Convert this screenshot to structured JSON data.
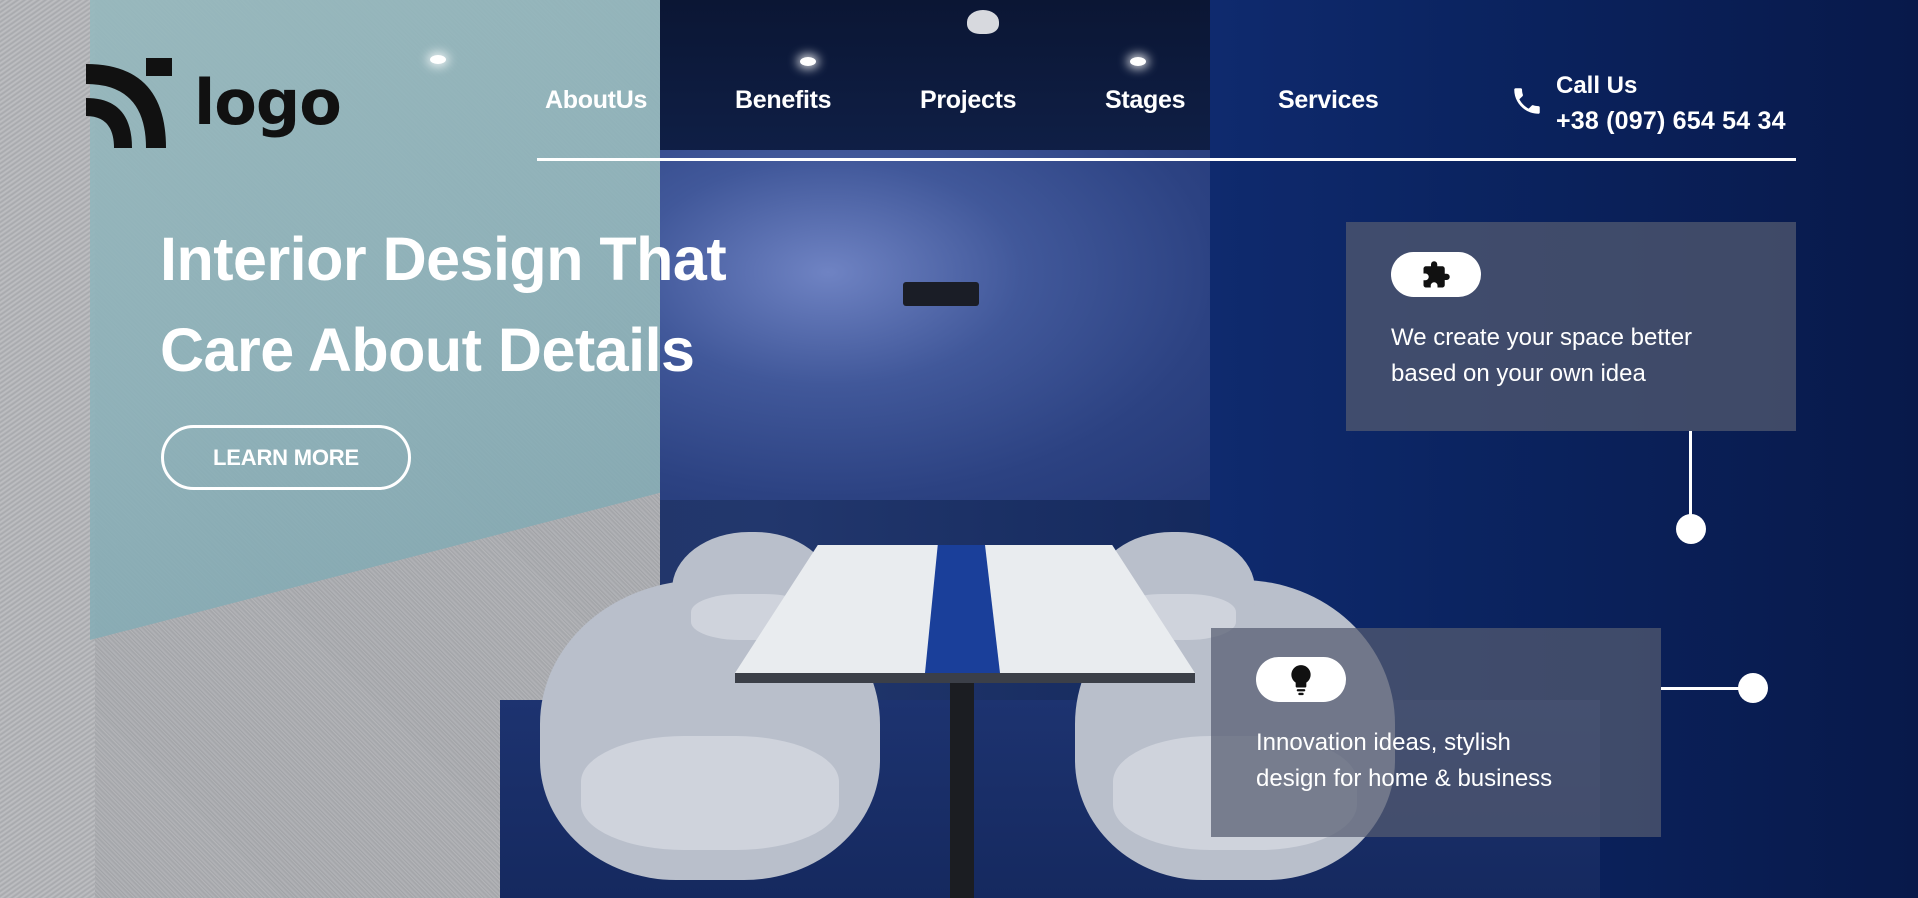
{
  "logo": {
    "text": "logo",
    "icon": "arcs-logo-icon"
  },
  "nav": {
    "items": [
      {
        "label": "AboutUs"
      },
      {
        "label": "Benefits"
      },
      {
        "label": "Projects"
      },
      {
        "label": "Stages"
      },
      {
        "label": "Services"
      }
    ]
  },
  "contact": {
    "icon": "phone-icon",
    "label": "Call Us",
    "number": "+38 (097) 654 54 34"
  },
  "hero": {
    "title_line1": "Interior Design That",
    "title_line2": "Care About Details",
    "cta_label": "LEARN MORE"
  },
  "features": [
    {
      "icon": "puzzle-icon",
      "line1": "We create your space better",
      "line2": "based on your own idea"
    },
    {
      "icon": "lightbulb-icon",
      "line1": "Innovation ideas, stylish",
      "line2": "design for home & business"
    }
  ],
  "colors": {
    "text": "#ffffff",
    "logo": "#111111",
    "card_bg": "rgba(85,92,112,0.72)",
    "accent_blue": "#1a3f9a"
  }
}
